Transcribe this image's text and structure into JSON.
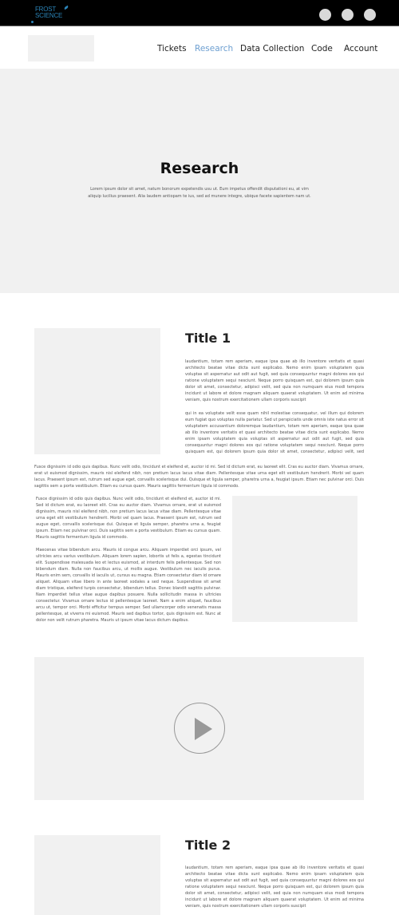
{
  "brand": {
    "line1": "FROST",
    "line2": "SCIENCE",
    "color": "#2b84b8"
  },
  "topbar": {
    "circle_buttons": [
      "circle-button-1",
      "circle-button-2",
      "circle-button-3"
    ]
  },
  "nav": {
    "items": [
      {
        "label": "Tickets",
        "active": false
      },
      {
        "label": "Research",
        "active": true
      },
      {
        "label": "Data Collection",
        "active": false
      },
      {
        "label": "Code",
        "active": false
      },
      {
        "label": "Account",
        "active": false
      }
    ],
    "active_color": "#6d9fd1"
  },
  "hero": {
    "title": "Research",
    "text": "Lorem ipsum dolor sit amet, natum bonorum expetendis usu ut. Eum impetus offendit disputationi eu, at vim aliquip lucilius praesent. Alia laudem antiopam te ius, sed ad munere integre, ubique facete sapientem nam ut."
  },
  "section1": {
    "title": "Title 1",
    "para1": "laudantium, totam rem aperiam, eaque ipsa quae ab illo inventore veritatis et quasi architecto beatae vitae dicta sunt explicabo. Nemo enim ipsam voluptatem quia voluptas sit aspernatur aut odit aut fugit, sed quia consequuntur magni dolores eos qui ratione voluptatem sequi nesciunt. Neque porro quisquam est, qui dolorem ipsum quia dolor sit amet, consectetur, adipisci velit, sed quia non numquam eius modi tempora incidunt ut labore et dolore magnam aliquam quaerat voluptatem. Ut enim ad minima veniam, quis nostrum exercitationem ullam corporis suscipit",
    "para2": "qui in ea voluptate velit esse quam nihil molestiae consequatur, vel illum qui dolorem eum fugiat quo voluptas nulla pariatur. Sed ut perspiciatis unde omnis iste natus error sit voluptatem accusantium doloremque laudantium, totam rem aperiam, eaque ipsa quae ab illo inventore veritatis et quasi architecto beatae vitae dicta sunt explicabo. Nemo enim ipsam voluptatem quia voluptas sit aspernatur aut odit aut fugit, sed quia consequuntur magni dolores eos qui ratione voluptatem sequi nesciunt. Neque porro quisquam est, qui dolorem ipsum quia dolor sit amet, consectetur, adipisci velit, sed quia",
    "wide_para": "Fusce dignissim id odio quis dapibus. Nunc velit odio, tincidunt et eleifend et, auctor id mi. Sed id dictum erat, eu laoreet elit. Cras eu auctor diam. Vivamus ornare, erat ut euismod dignissim, mauris nisl eleifend nibh, non pretium lacus lacus vitae diam. Pellentesque vitae urna eget elit vestibulum hendrerit. Morbi vel quam lacus. Praesent ipsum est, rutrum sed augue eget, convallis scelerisque dui. Quisque et ligula semper, pharetra urna a, feugiat ipsum. Etiam nec pulvinar orci. Duis sagittis sem a porta vestibulum. Etiam eu cursus quam. Mauris sagittis fermentum ligula id commodo.",
    "left_para1": "Fusce dignissim id odio quis dapibus. Nunc velit odio, tincidunt et eleifend et, auctor id mi. Sed id dictum erat, eu laoreet elit. Cras eu auctor diam. Vivamus ornare, erat ut euismod dignissim, mauris nisl eleifend nibh, non pretium lacus lacus vitae diam. Pellentesque vitae urna eget elit vestibulum hendrerit. Morbi vel quam lacus. Praesent ipsum est, rutrum sed augue eget, convallis scelerisque dui. Quisque et ligula semper, pharetra urna a, feugiat ipsum. Etiam nec pulvinar orci. Duis sagittis sem a porta vestibulum. Etiam eu cursus quam. Mauris sagittis fermentum ligula id commodo.",
    "left_para2": "Maecenas vitae bibendum arcu. Mauris id congue arcu. Aliquam imperdiet orci ipsum, vel ultricies arcu varius vestibulum. Aliquam lorem sapien, lobortis ut felis a, egestas tincidunt elit. Suspendisse malesuada leo et lectus euismod, at interdum felis pellentesque. Sed non bibendum diam. Nulla non faucibus arcu, ut mollis augue. Vestibulum nec iaculis purus. Mauris enim sem, convallis id iaculis ut, cursus eu magna. Etiam consectetur diam id ornare aliquet. Aliquam vitae libero in ante laoreet sodales a sed neque. Suspendisse sit amet diam tristique, eleifend turpis consectetur, bibendum tellus. Donec blandit sagittis pulvinar. Nam imperdiet tellus vitae augue dapibus posuere. Nulla sollicitudin massa in ultricies consectetur. Vivamus ornare lectus id pellentesque laoreet. Nam a enim aliquet, faucibus arcu ut, tempor orci. Morbi efficitur tempus semper. Sed ullamcorper odio venenatis massa pellentesque, at viverra mi euismod. Mauris sed dapibus tortor, quis dignissim est. Nunc at dolor non velit rutrum pharetra. Mauris ut ipsum vitae lacus dictum dapibus."
  },
  "video": {
    "play_icon": "play-icon"
  },
  "section2": {
    "title": "Title 2",
    "para1": "laudantium, totam rem aperiam, eaque ipsa quae ab illo inventore veritatis et quasi architecto beatae vitae dicta sunt explicabo. Nemo enim ipsam voluptatem quia voluptas sit aspernatur aut odit aut fugit, sed quia consequuntur magni dolores eos qui ratione voluptatem sequi nesciunt. Neque porro quisquam est, qui dolorem ipsum quia dolor sit amet, consectetur, adipisci velit, sed quia non numquam eius modi tempora incidunt ut labore et dolore magnam aliquam quaerat voluptatem. Ut enim ad minima veniam, quis nostrum exercitationem ullam corporis suscipit"
  }
}
